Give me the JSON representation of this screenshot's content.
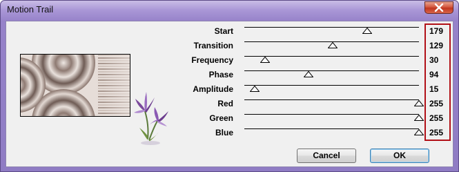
{
  "window": {
    "title": "Motion Trail",
    "close_icon": "close-x-icon"
  },
  "sliders": [
    {
      "label": "Start",
      "value": "179",
      "level": 0.702
    },
    {
      "label": "Transition",
      "value": "129",
      "level": 0.506
    },
    {
      "label": "Frequency",
      "value": "30",
      "level": 0.118
    },
    {
      "label": "Phase",
      "value": "94",
      "level": 0.369
    },
    {
      "label": "Amplitude",
      "value": "15",
      "level": 0.059
    },
    {
      "label": "Red",
      "value": "255",
      "level": 1.0
    },
    {
      "label": "Green",
      "value": "255",
      "level": 1.0
    },
    {
      "label": "Blue",
      "value": "255",
      "level": 1.0
    }
  ],
  "buttons": {
    "cancel": "Cancel",
    "ok": "OK"
  },
  "colors": {
    "highlight": "#b10f16",
    "preview_dark": "#6a5851",
    "preview_light": "#efe8e4",
    "title_bar": "#9682c9"
  }
}
